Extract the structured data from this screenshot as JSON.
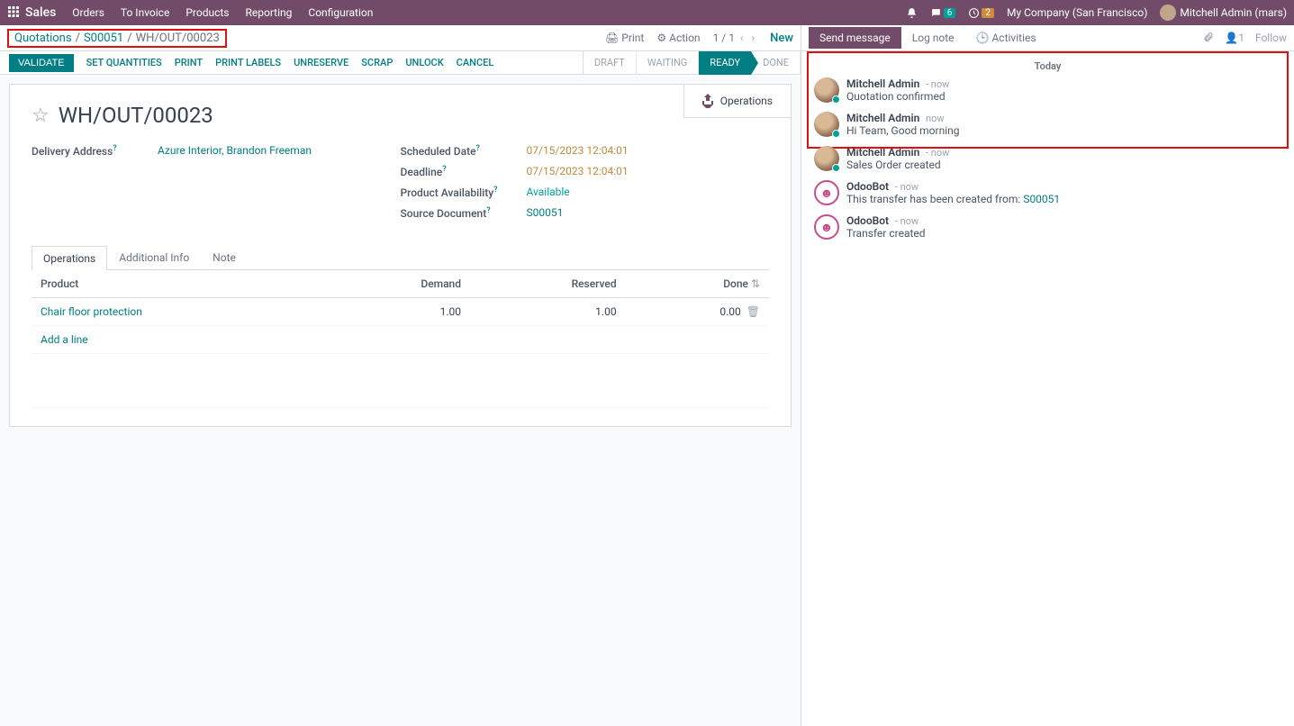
{
  "topnav": {
    "brand": "Sales",
    "items": [
      "Orders",
      "To Invoice",
      "Products",
      "Reporting",
      "Configuration"
    ],
    "chat_badge": "6",
    "activity_badge": "2",
    "company": "My Company (San Francisco)",
    "user": "Mitchell Admin (mars)"
  },
  "breadcrumb": {
    "a": "Quotations",
    "b": "S00051",
    "c": "WH/OUT/00023"
  },
  "controls": {
    "print": "Print",
    "action": "Action",
    "pager": "1 / 1",
    "new": "New"
  },
  "actions": {
    "validate": "VALIDATE",
    "set_quantities": "SET QUANTITIES",
    "print": "PRINT",
    "print_labels": "PRINT LABELS",
    "unreserve": "UNRESERVE",
    "scrap": "SCRAP",
    "unlock": "UNLOCK",
    "cancel": "CANCEL"
  },
  "status": {
    "draft": "DRAFT",
    "waiting": "WAITING",
    "ready": "READY",
    "done": "DONE"
  },
  "sheet": {
    "smart_button": "Operations",
    "title": "WH/OUT/00023",
    "delivery_address_label": "Delivery Address",
    "delivery_address": "Azure Interior, Brandon Freeman",
    "scheduled_date_label": "Scheduled Date",
    "scheduled_date": "07/15/2023 12:04:01",
    "deadline_label": "Deadline",
    "deadline": "07/15/2023 12:04:01",
    "product_availability_label": "Product Availability",
    "product_availability": "Available",
    "source_document_label": "Source Document",
    "source_document": "S00051"
  },
  "tabs": {
    "operations": "Operations",
    "additional_info": "Additional Info",
    "note": "Note"
  },
  "grid": {
    "h_product": "Product",
    "h_demand": "Demand",
    "h_reserved": "Reserved",
    "h_done": "Done",
    "row_product": "Chair floor protection",
    "row_demand": "1.00",
    "row_reserved": "1.00",
    "row_done": "0.00",
    "add_line": "Add a line"
  },
  "chatter": {
    "send_message": "Send message",
    "log_note": "Log note",
    "activities": "Activities",
    "followers": "1",
    "follow": "Follow",
    "today": "Today",
    "messages": [
      {
        "author": "Mitchell Admin",
        "time": "now",
        "text": "Quotation confirmed",
        "avatar_type": "user"
      },
      {
        "author": "Mitchell Admin",
        "time": "now",
        "text": "Hi Team, Good morning",
        "avatar_type": "user"
      },
      {
        "author": "Mitchell Admin",
        "time": "now",
        "text": "Sales Order created",
        "avatar_type": "user"
      },
      {
        "author": "OdooBot",
        "time": "now",
        "text": "This transfer has been created from: ",
        "link": "S00051",
        "avatar_type": "bot"
      },
      {
        "author": "OdooBot",
        "time": "now",
        "text": "Transfer created",
        "avatar_type": "bot"
      }
    ]
  }
}
